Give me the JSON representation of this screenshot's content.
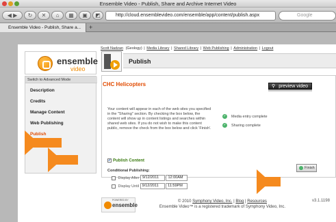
{
  "browser": {
    "window_title": "Ensemble Video - Publish, Share and Archive Internet Video",
    "url": "http://cloud.ensemblevideo.com/ensemble/app/content/publish.aspx",
    "search_placeholder": "Google",
    "tab_title": "Ensemble Video - Publish, Share a...",
    "new_tab": "+"
  },
  "top_links": {
    "user": "Scott Nadzan",
    "dept": "(Geology)",
    "items": [
      "Media Library",
      "Shared Library",
      "Web Publishing",
      "Administration",
      "Logout"
    ]
  },
  "logo": {
    "name": "ensemble",
    "sub": "video"
  },
  "sidebar": {
    "mode_link": "Switch to Advanced Mode",
    "items": [
      "Description",
      "Credits",
      "Manage Content",
      "Web Publishing",
      "Publish"
    ],
    "active": "Publish"
  },
  "header": {
    "title": "Publish"
  },
  "content": {
    "title": "CHC Helicopters",
    "preview_label": "preview video",
    "description": "Your content will appear in each of the web sites you specified in the \"Sharing\" section. By checking the box below, the content will show up in content listings and searches within shared web sites. If you do not wish to make this content public, remove the check from the box below and click 'Finish'.",
    "status": [
      "Media entry complete",
      "Sharing complete"
    ],
    "publish_label": "Publish Content",
    "conditional_label": "Conditional Publishing:",
    "display_after_label": "Display After",
    "display_after_date": "9/12/2011",
    "display_after_time": "12:00AM",
    "display_until_label": "Display Until",
    "display_until_date": "9/12/2011",
    "display_until_time": "11:59PM",
    "finish_label": "Finish"
  },
  "footer": {
    "powered_by": "POWERED BY",
    "brand": "ensemble",
    "copyright_prefix": "© 2010",
    "company_link": "Symphony Video, Inc.",
    "blog": "Blog",
    "resources": "Resources",
    "trademark": "Ensemble Video™ is a registered trademark of Symphony Video, Inc.",
    "version": "v3.1.1198"
  }
}
